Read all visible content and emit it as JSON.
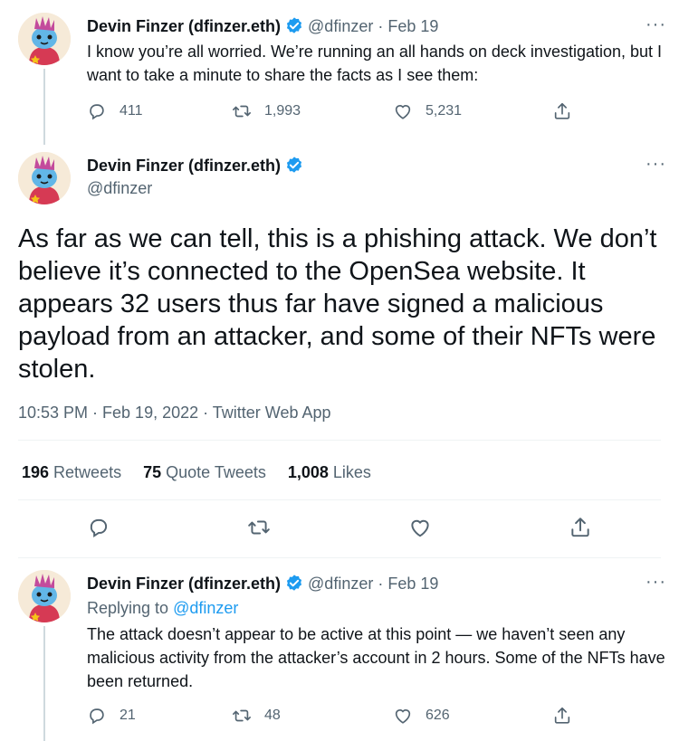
{
  "colors": {
    "accent": "#1d9bf0",
    "muted": "#536471",
    "text": "#0f1419",
    "line": "#cfd9de"
  },
  "tweet1": {
    "name": "Devin Finzer (dfinzer.eth)",
    "handle": "@dfinzer",
    "sep": "·",
    "date": "Feb 19",
    "more": "···",
    "text": "I know you’re all worried. We’re running an all hands on deck investigation, but I want to take a minute to share the facts as I see them:",
    "replies": "411",
    "retweets": "1,993",
    "likes": "5,231",
    "icons": [
      "reply-icon",
      "retweet-icon",
      "like-icon",
      "share-icon"
    ]
  },
  "main": {
    "name": "Devin Finzer (dfinzer.eth)",
    "handle": "@dfinzer",
    "more": "···",
    "text": "As far as we can tell, this is a phishing attack. We don’t believe it’s connected to the OpenSea website. It appears 32 users thus far have signed a malicious payload from an attacker, and some of their NFTs were stolen.",
    "timestamp": "10:53 PM · Feb 19, 2022 · Twitter Web App",
    "retweets_count": "196",
    "retweets_label": "Retweets",
    "quotes_count": "75",
    "quotes_label": "Quote Tweets",
    "likes_count": "1,008",
    "likes_label": "Likes"
  },
  "tweet3": {
    "name": "Devin Finzer (dfinzer.eth)",
    "handle": "@dfinzer",
    "sep": "·",
    "date": "Feb 19",
    "more": "···",
    "replying_prefix": "Replying to",
    "replying_handle": "@dfinzer",
    "text": "The attack doesn’t appear to be active at this point — we haven’t seen any malicious activity from the attacker’s account in 2 hours. Some of the NFTs have been returned.",
    "replies": "21",
    "retweets": "48",
    "likes": "626"
  }
}
